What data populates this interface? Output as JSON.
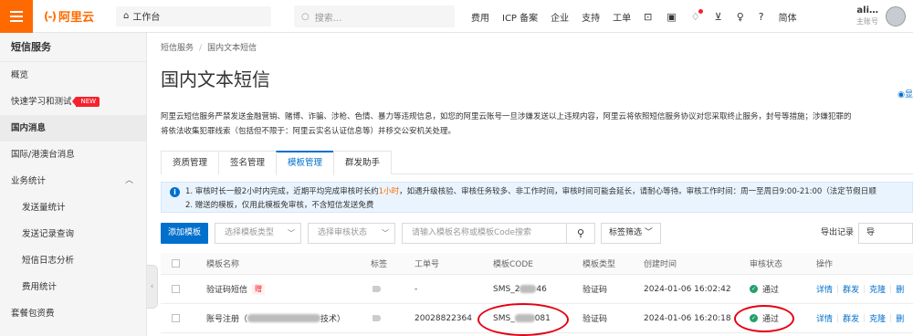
{
  "topbar": {
    "logo_mark": "(-)",
    "logo_text": "阿里云",
    "workbench": "工作台",
    "search_placeholder": "搜索...",
    "nav": [
      "费用",
      "ICP 备案",
      "企业",
      "支持",
      "工单"
    ],
    "lang": "简体",
    "user_name": "ali…",
    "user_sub": "主账号",
    "icons": [
      "menu-icon",
      "home-icon",
      "search-icon",
      "scan-icon",
      "terminal-icon",
      "bell-icon",
      "cart-icon",
      "bulb-icon",
      "help-icon"
    ]
  },
  "sidebar": {
    "title": "短信服务",
    "items": [
      {
        "label": "概览"
      },
      {
        "label": "快速学习和测试",
        "badge": "NEW"
      },
      {
        "label": "国内消息"
      },
      {
        "label": "国际/港澳台消息"
      },
      {
        "label": "业务统计"
      },
      {
        "label": "发送量统计"
      },
      {
        "label": "发送记录查询"
      },
      {
        "label": "短信日志分析"
      },
      {
        "label": "费用统计"
      },
      {
        "label": "套餐包资费"
      }
    ]
  },
  "main": {
    "breadcrumb": [
      "短信服务",
      "国内文本短信"
    ],
    "title": "国内文本短信",
    "right_link": "显",
    "warning_line1": "阿里云短信服务严禁发送金融营销、赌博、诈骗、涉枪、色情、暴力等违规信息，如您的阿里云账号一旦涉嫌发送以上违规内容，阿里云将依照短信服务协议对您采取终止服务，封号等措施；涉嫌犯罪的",
    "warning_line2": "将依法收集犯罪线索（包括但不限于：阿里云实名认证信息等）并移交公安机关处理。",
    "tabs": [
      "资质管理",
      "签名管理",
      "模板管理",
      "群发助手"
    ],
    "info_line1_pre": "1. 审核时长一般2小时内完成，近期平均完成审核时长约",
    "info_line1_hl": "1小时",
    "info_line1_post": "，如遇升级核验、审核任务较多、非工作时间，审核时间可能会延长，请耐心等待。审核工作时间：周一至周日9:00-21:00（法定节假日顺",
    "info_line2": "2. 赠送的模板，仅用此模板免审核，不含短信发送免费",
    "toolbar": {
      "add": "添加模板",
      "type_select": "选择模板类型",
      "status_select": "选择审核状态",
      "keyword_placeholder": "请输入模板名称或模板Code搜索",
      "tag_filter": "标签筛选",
      "export": "导出记录",
      "import": "导"
    },
    "table": {
      "headers": [
        "模板名称",
        "标签",
        "工单号",
        "模板CODE",
        "模板类型",
        "创建时间",
        "审核状态",
        "操作"
      ],
      "rows": [
        {
          "name": "验证码短信",
          "badge": "赠",
          "ticket": "-",
          "code_pre": "SMS_2",
          "code_post": "46",
          "type": "验证码",
          "created": "2024-01-06 16:02:42",
          "status": "通过",
          "ops": [
            "详情",
            "群发",
            "克隆",
            "删"
          ]
        },
        {
          "name_pre": "账号注册（",
          "name_post": "技术）",
          "ticket": "20028822364",
          "code_pre": "SMS_",
          "code_post": "081",
          "type": "验证码",
          "created": "2024-01-06 16:20:18",
          "status": "通过",
          "ops": [
            "详情",
            "群发",
            "克隆",
            "删"
          ]
        }
      ]
    }
  },
  "colors": {
    "brand": "#ff6a00",
    "primary": "#0070cc",
    "success": "#22a06b",
    "annotation": "#e60012"
  }
}
